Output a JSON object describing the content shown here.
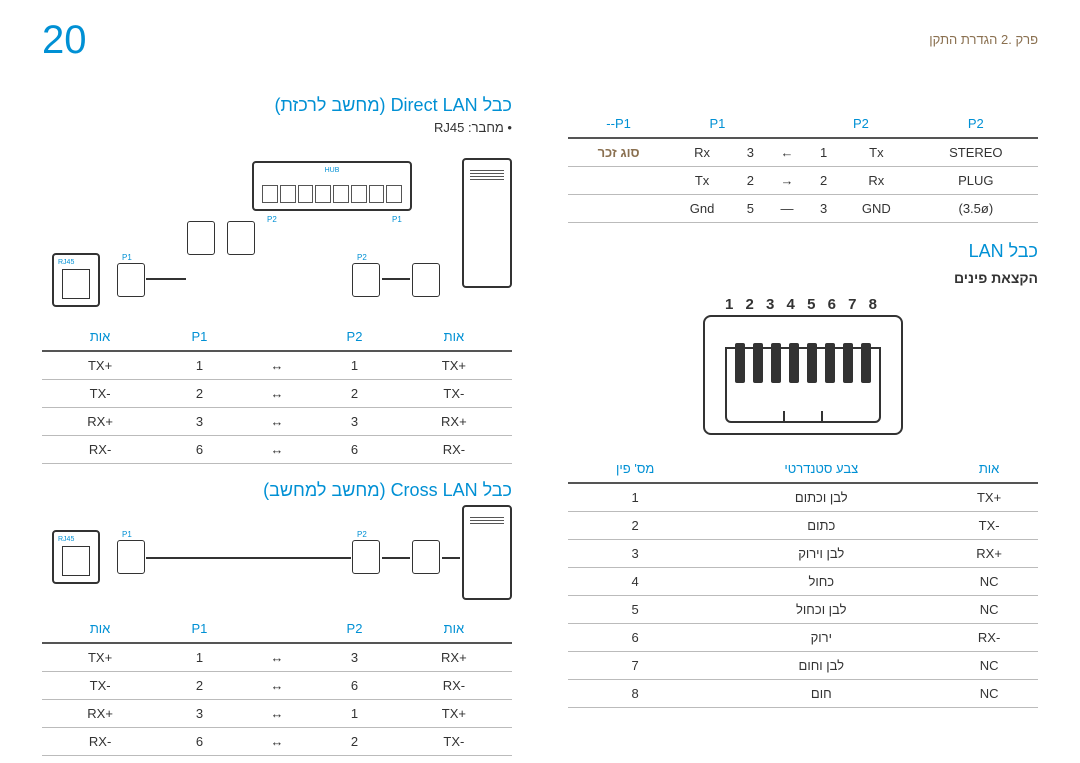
{
  "page_number": "20",
  "chapter": "פרק .2 הגדרת התקן",
  "stereo_table": {
    "headers": [
      "--P1",
      "P1",
      "",
      "P2",
      "",
      "P2"
    ],
    "rows": [
      [
        "סוג זכר",
        "Rx",
        "3",
        "←",
        "1",
        "Tx",
        "STEREO"
      ],
      [
        "",
        "Tx",
        "2",
        "→",
        "2",
        "Rx",
        "PLUG"
      ],
      [
        "",
        "Gnd",
        "5",
        "—",
        "3",
        "GND",
        "(3.5ø)"
      ]
    ]
  },
  "lan_title": "כבל LAN",
  "pin_assignment": "הקצאת פינים",
  "pin_numbers": "1 2 3 4 5 6 7 8",
  "pin_table": {
    "headers": [
      "מס' פין",
      "צבע סטנדרטי",
      "אות"
    ],
    "rows": [
      [
        "1",
        "לבן וכתום",
        "TX+"
      ],
      [
        "2",
        "כתום",
        "TX-"
      ],
      [
        "3",
        "לבן וירוק",
        "RX+"
      ],
      [
        "4",
        "כחול",
        "NC"
      ],
      [
        "5",
        "לבן וכחול",
        "NC"
      ],
      [
        "6",
        "ירוק",
        "RX-"
      ],
      [
        "7",
        "לבן וחום",
        "NC"
      ],
      [
        "8",
        "חום",
        "NC"
      ]
    ]
  },
  "direct_title": "כבל Direct LAN (מחשב לרכזת)",
  "connector_note": "• מחבר: RJ45",
  "hub_label": "HUB",
  "rj45_label": "RJ45",
  "p1": "P1",
  "p2": "P2",
  "direct_table": {
    "headers": [
      "אות",
      "P1",
      "",
      "P2",
      "אות"
    ],
    "rows": [
      [
        "TX+",
        "1",
        "↔",
        "1",
        "TX+"
      ],
      [
        "TX-",
        "2",
        "↔",
        "2",
        "TX-"
      ],
      [
        "RX+",
        "3",
        "↔",
        "3",
        "RX+"
      ],
      [
        "RX-",
        "6",
        "↔",
        "6",
        "RX-"
      ]
    ]
  },
  "cross_title": "כבל Cross LAN (מחשב למחשב)",
  "cross_table": {
    "headers": [
      "אות",
      "P1",
      "",
      "P2",
      "אות"
    ],
    "rows": [
      [
        "TX+",
        "1",
        "↔",
        "3",
        "RX+"
      ],
      [
        "TX-",
        "2",
        "↔",
        "6",
        "RX-"
      ],
      [
        "RX+",
        "3",
        "↔",
        "1",
        "TX+"
      ],
      [
        "RX-",
        "6",
        "↔",
        "2",
        "TX-"
      ]
    ]
  }
}
